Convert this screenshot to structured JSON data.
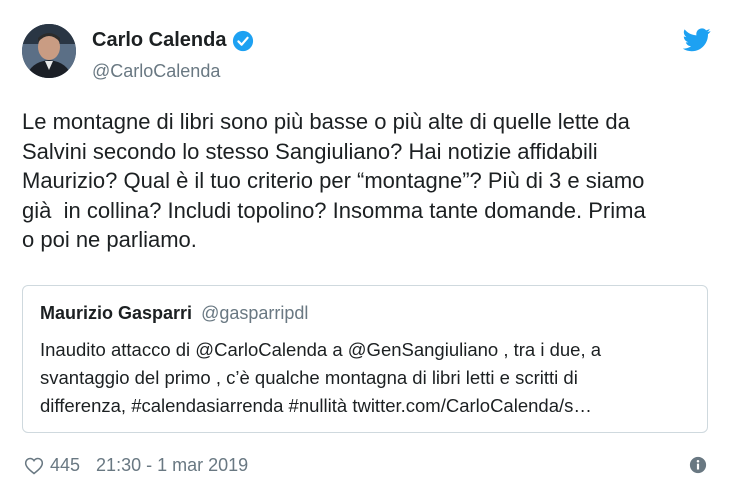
{
  "author": {
    "name": "Carlo Calenda",
    "handle": "@CarloCalenda"
  },
  "tweet": {
    "text": "Le montagne di libri sono più basse o più alte di quelle lette da\nSalvini secondo lo stesso Sangiuliano? Hai notizie affidabili\nMaurizio? Qual è il tuo criterio per “montagne”? Più di 3 e siamo\ngià  in collina? Includi topolino? Insomma tante domande. Prima\no poi ne parliamo."
  },
  "quoted": {
    "name": "Maurizio Gasparri",
    "handle": "@gasparripdl",
    "text": "Inaudito attacco di @CarloCalenda a @GenSangiuliano , tra i due, a\nsvantaggio del primo , c’è qualche montagna di libri letti e scritti di\ndifferenza, #calendasiarrenda #nullità twitter.com/CarloCalenda/s…"
  },
  "footer": {
    "likes": "445",
    "timestamp": "21:30 - 1 mar 2019"
  },
  "colors": {
    "twitter_blue": "#1da1f2",
    "muted": "#697882",
    "text": "#1c2022",
    "border": "#cfd9de"
  },
  "icons": {
    "verified": "verified-badge-icon",
    "brand": "twitter-bird-icon",
    "like": "heart-icon",
    "info": "info-icon"
  }
}
